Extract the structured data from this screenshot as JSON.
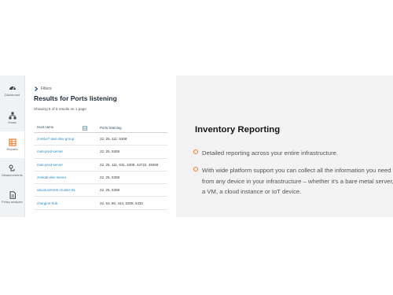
{
  "sidebar": {
    "items": [
      {
        "label": "Dashboard",
        "icon": "dashboard-icon"
      },
      {
        "label": "Hosts",
        "icon": "hosts-icon"
      },
      {
        "label": "Reports",
        "icon": "reports-icon",
        "active": true
      },
      {
        "label": "Measurements",
        "icon": "measurements-icon"
      },
      {
        "label": "Policy analyzer",
        "icon": "policy-analyzer-icon"
      }
    ]
  },
  "panel": {
    "filters_label": "Filters",
    "title": "Results for Ports listening",
    "showing": "Showing 6 of 6 results on 1 page",
    "columns": [
      "Host name",
      "Ports listening"
    ],
    "rows": [
      {
        "host": "zombo7-aws-dev-group",
        "ports": "22, 25, 111, 5308"
      },
      {
        "host": "muti-prod-server",
        "ports": "22, 25, 5308"
      },
      {
        "host": "muti-prod-server",
        "ports": "22, 25, 111, 631, 5308, 44722, 49259"
      },
      {
        "host": "zenkab-dev-server",
        "ports": "22, 25, 5308"
      },
      {
        "host": "ubuntu18-test-cluster-01",
        "ports": "22, 25, 5308"
      },
      {
        "host": "chergine-hub",
        "ports": "22, 53, 80, 443, 5308, 5432"
      }
    ]
  },
  "marketing": {
    "title": "Inventory Reporting",
    "bullets": [
      "Detailed reporting across your entire infrastructure.",
      "With wide platform support you can collect all the information you need from any device in your infrastructure – whether it's a bare metal server, a VM, a cloud instance or IoT device."
    ]
  },
  "colors": {
    "link": "#2b89c9",
    "accent": "#ef7a2b",
    "active_icon": "#ef7a2b",
    "heading": "#1f2a3a"
  }
}
